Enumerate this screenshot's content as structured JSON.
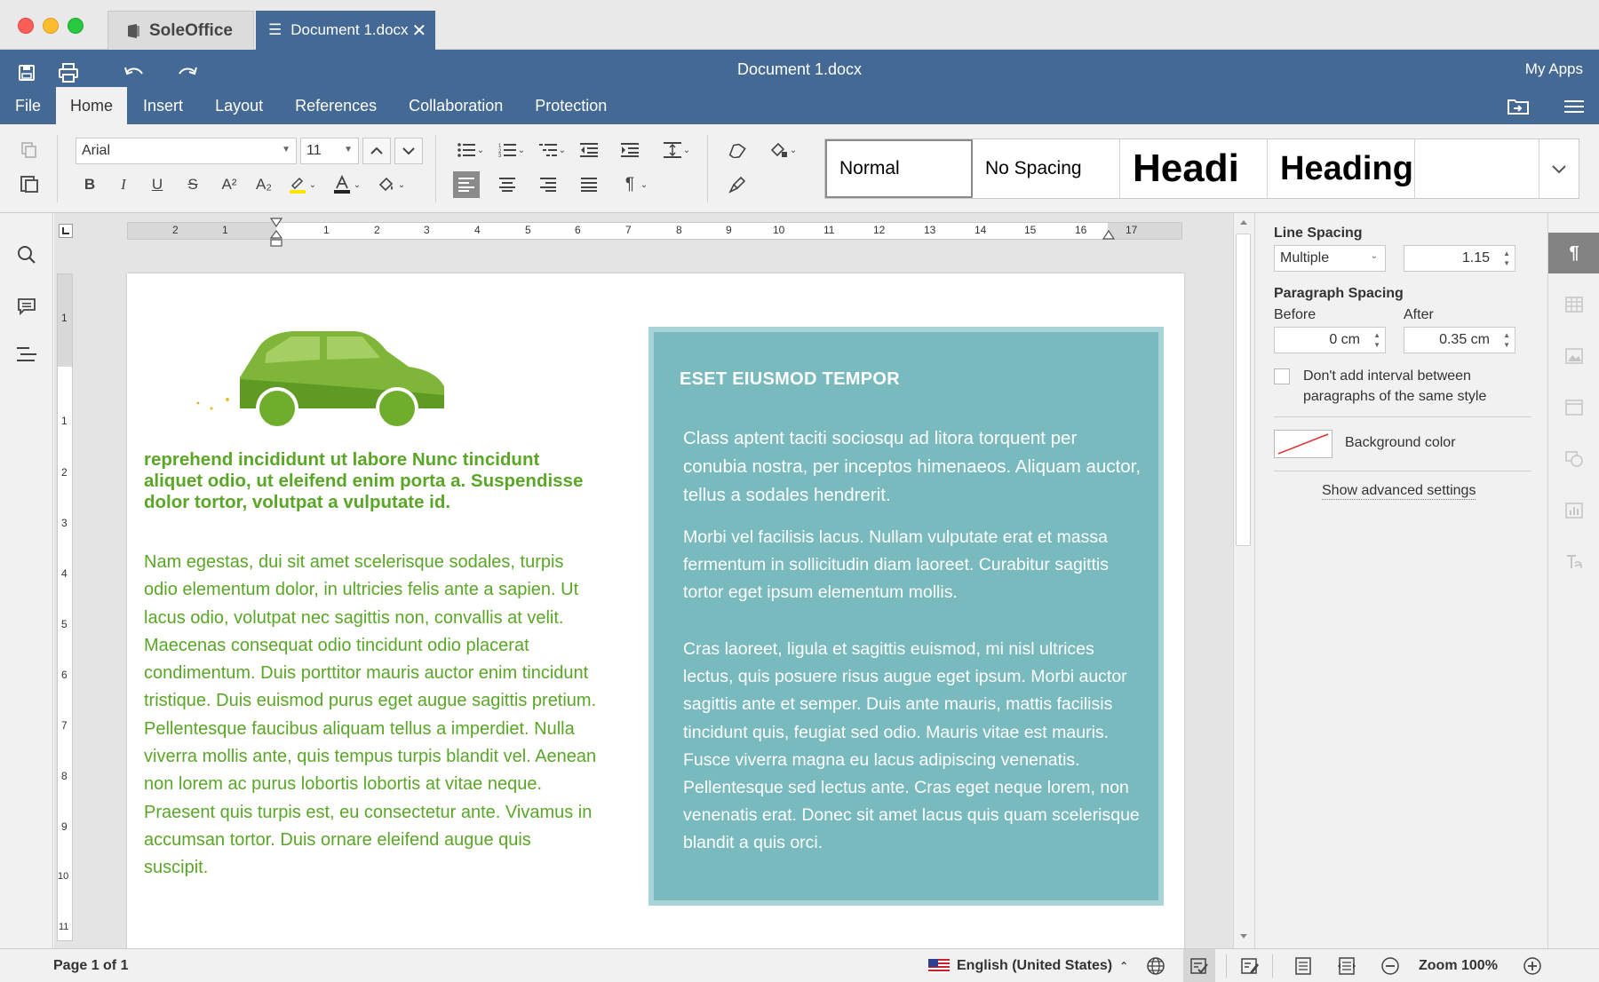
{
  "window": {
    "app_tab": "SoleOffice",
    "doc_tab": "Document 1.docx",
    "title": "Document 1.docx",
    "my_apps": "My Apps"
  },
  "menu": [
    "File",
    "Home",
    "Insert",
    "Layout",
    "References",
    "Collaboration",
    "Protection"
  ],
  "toolbar": {
    "font_name": "Arial",
    "font_size": "11",
    "styles": [
      "Normal",
      "No Spacing",
      "Headi",
      "Heading"
    ]
  },
  "document": {
    "green_heading": "reprehend incididunt ut labore Nunc tincidunt aliquet odio, ut eleifend enim porta a. Suspendisse dolor tortor, volutpat a vulputate id.",
    "green_body": "Nam egestas, dui sit amet scelerisque sodales, turpis odio elementum dolor, in ultricies felis ante a sapien. Ut lacus odio, volutpat nec sagittis non, convallis at velit. Maecenas consequat odio tincidunt odio placerat condimentum. Duis porttitor mauris auctor enim tincidunt tristique. Duis euismod purus eget augue sagittis pretium. Pellentesque faucibus aliquam tellus a imperdiet. Nulla viverra mollis ante, quis tempus turpis blandit vel. Aenean non lorem ac purus lobortis lobortis at vitae neque. Praesent quis turpis est, eu consectetur ante. Vivamus in accumsan tortor. Duis ornare eleifend augue quis suscipit.",
    "teal_title": "ESET EIUSMOD TEMPOR",
    "teal_p1": "Class aptent taciti sociosqu ad litora torquent per conubia nostra, per inceptos himenaeos. Aliquam auctor, tellus a sodales hendrerit.",
    "teal_p2": "Morbi vel facilisis lacus. Nullam vulputate erat et massa fermentum in sollicitudin diam laoreet. Curabitur sagittis tortor eget ipsum elementum mollis.",
    "teal_p3": "Cras laoreet, ligula et sagittis euismod, mi nisl ultrices lectus, quis posuere risus augue eget ipsum. Morbi auctor sagittis ante et semper. Duis ante mauris, mattis facilisis tincidunt quis, feugiat sed odio. Mauris vitae est mauris. Fusce viverra magna eu lacus adipiscing venenatis. Pellentesque sed lectus ante. Cras eget neque lorem, non venenatis erat. Donec sit amet lacus quis quam scelerisque blandit a quis orci."
  },
  "ruler": {
    "h_left_labels": [
      "2",
      "1"
    ],
    "h_labels": [
      "1",
      "2",
      "3",
      "4",
      "5",
      "6",
      "7",
      "8",
      "9",
      "10",
      "11",
      "12",
      "13",
      "14",
      "15",
      "16",
      "17"
    ],
    "v_labels": [
      "1",
      "1",
      "2",
      "3",
      "4",
      "5",
      "6",
      "7",
      "8",
      "9",
      "10",
      "11"
    ]
  },
  "panel": {
    "line_spacing_label": "Line Spacing",
    "line_spacing_mode": "Multiple",
    "line_spacing_value": "1.15",
    "paragraph_spacing_label": "Paragraph Spacing",
    "before_label": "Before",
    "after_label": "After",
    "before_value": "0 cm",
    "after_value": "0.35 cm",
    "checkbox_label": "Don't add interval between paragraphs of the same style",
    "background_color_label": "Background color",
    "advanced_link": "Show advanced settings"
  },
  "status": {
    "page": "Page 1 of 1",
    "language": "English (United States)",
    "zoom": "Zoom 100%"
  },
  "colors": {
    "header": "#446995",
    "green_text": "#5aa627",
    "teal_box": "#79babf"
  }
}
